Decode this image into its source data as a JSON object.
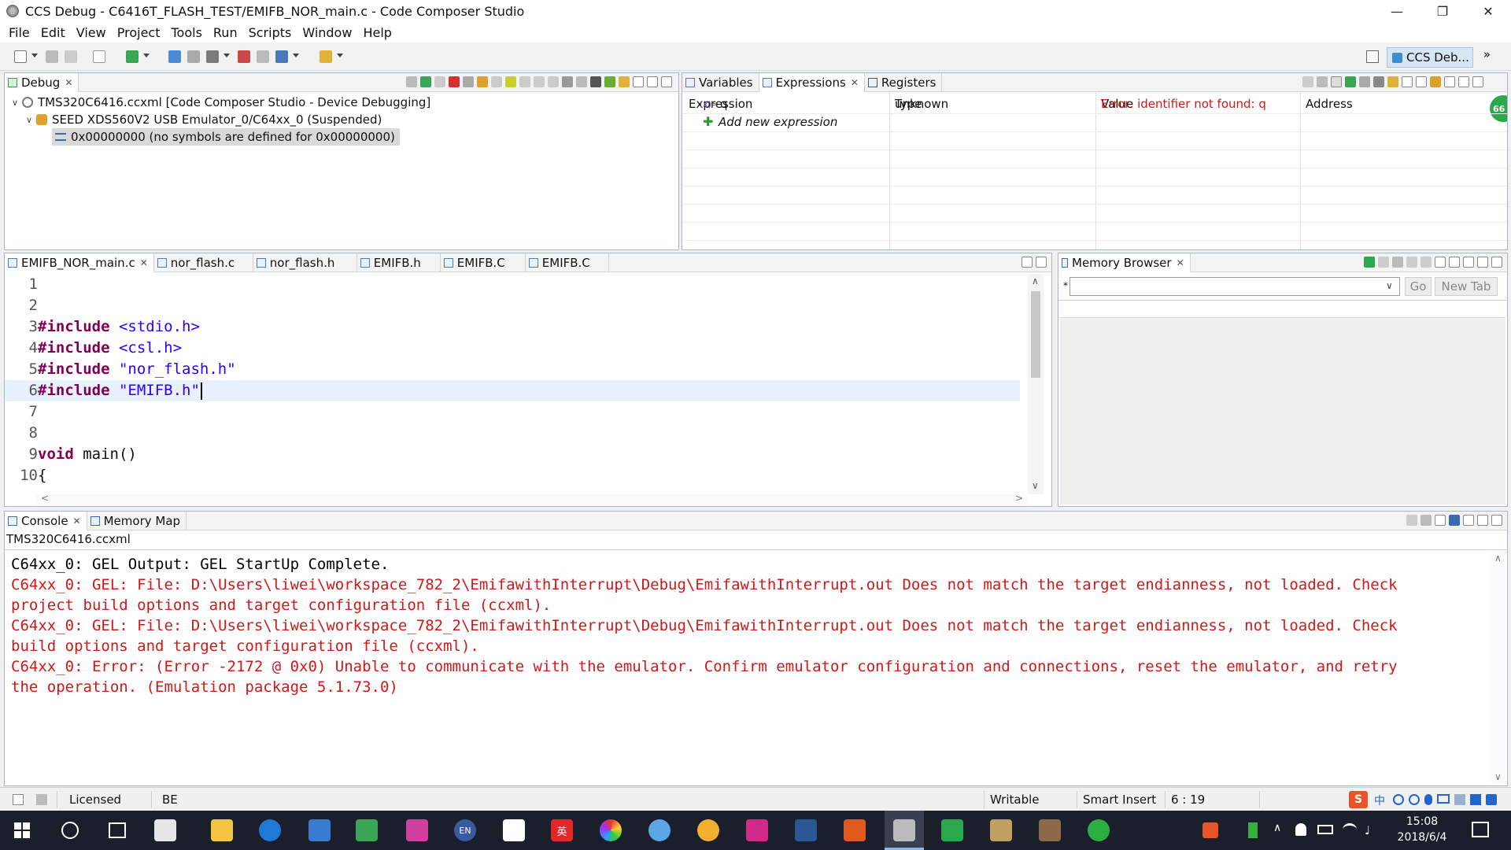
{
  "window": {
    "title": "CCS Debug - C6416T_FLASH_TEST/EMIFB_NOR_main.c - Code Composer Studio",
    "controls": {
      "minimize": "—",
      "restore": "❐",
      "close": "✕"
    }
  },
  "menu": [
    "File",
    "Edit",
    "View",
    "Project",
    "Tools",
    "Run",
    "Scripts",
    "Window",
    "Help"
  ],
  "perspective": {
    "label": "CCS Deb...",
    "more": "»"
  },
  "debug_view": {
    "tab_label": "Debug",
    "tree": [
      {
        "text": "TMS320C6416.ccxml [Code Composer Studio - Device Debugging]",
        "level": 0,
        "expanded": true,
        "icon": "target-config-icon"
      },
      {
        "text": "SEED XDS560V2 USB Emulator_0/C64xx_0 (Suspended)",
        "level": 1,
        "expanded": true,
        "icon": "cpu-core-icon"
      },
      {
        "text": "0x00000000  (no symbols are defined for 0x00000000)",
        "level": 2,
        "selected": true,
        "icon": "stack-frame-icon"
      }
    ]
  },
  "expressions_view": {
    "tabs": [
      {
        "label": "Variables",
        "icon": "variables-icon"
      },
      {
        "label": "Expressions",
        "icon": "expressions-icon",
        "active": true
      },
      {
        "label": "Registers",
        "icon": "registers-icon"
      }
    ],
    "columns": [
      "Expression",
      "Type",
      "Value",
      "Address"
    ],
    "rows": [
      {
        "expression": "q",
        "type": "unknown",
        "value": "Error: identifier not found: q",
        "address": ""
      }
    ],
    "add_new": "Add new expression",
    "badge": "66"
  },
  "editor": {
    "tabs": [
      {
        "label": "EMIFB_NOR_main.c",
        "active": true
      },
      {
        "label": "nor_flash.c"
      },
      {
        "label": "nor_flash.h"
      },
      {
        "label": "EMIFB.h"
      },
      {
        "label": "EMIFB.C"
      },
      {
        "label": "EMIFB.C"
      }
    ],
    "lines": [
      {
        "num": "1",
        "kw": "",
        "text": ""
      },
      {
        "num": "2",
        "kw": "",
        "text": ""
      },
      {
        "num": "3",
        "kw": "#include",
        "text": " <stdio.h>"
      },
      {
        "num": "4",
        "kw": "#include",
        "text": " <csl.h>"
      },
      {
        "num": "5",
        "kw": "#include",
        "text": " \"nor_flash.h\""
      },
      {
        "num": "6",
        "kw": "#include",
        "text": " \"EMIFB.h\""
      },
      {
        "num": "7",
        "kw": "",
        "text": ""
      },
      {
        "num": "8",
        "kw": "",
        "text": ""
      },
      {
        "num": "9",
        "kw": "void",
        "text": " main()"
      },
      {
        "num": "10",
        "kw": "",
        "text": "{"
      }
    ],
    "current_line": 6
  },
  "memory_browser": {
    "tab_label": "Memory Browser",
    "address_placeholder": "",
    "go_label": "Go",
    "new_tab_label": "New Tab"
  },
  "console": {
    "tabs": [
      {
        "label": "Console",
        "active": true
      },
      {
        "label": "Memory Map"
      }
    ],
    "header": "TMS320C6416.ccxml",
    "lines": [
      {
        "text": "C64xx_0: GEL Output: GEL StartUp Complete.",
        "kind": "normal"
      },
      {
        "text": "C64xx_0: GEL: File: D:\\Users\\liwei\\workspace_782_2\\EmifawithInterrupt\\Debug\\EmifawithInterrupt.out Does not match the target endianness, not loaded. Check",
        "kind": "err"
      },
      {
        "text": "project build options and target configuration file (ccxml).",
        "kind": "err"
      },
      {
        "text": "C64xx_0: GEL: File: D:\\Users\\liwei\\workspace_782_2\\EmifawithInterrupt\\Debug\\EmifawithInterrupt.out Does not match the target endianness, not loaded. Check",
        "kind": "err"
      },
      {
        "text": "build options and target configuration file (ccxml).",
        "kind": "err"
      },
      {
        "text": "C64xx_0: Error: (Error -2172 @ 0x0) Unable to communicate with the emulator. Confirm emulator configuration and connections, reset the emulator, and retry",
        "kind": "err"
      },
      {
        "text": "the operation. (Emulation package 5.1.73.0)",
        "kind": "err"
      }
    ]
  },
  "statusbar": {
    "license": "Licensed",
    "endian": "BE",
    "mode": "Writable",
    "insert": "Smart Insert",
    "position": "6 : 19"
  },
  "taskbar": {
    "time": "15:08",
    "date": "2018/6/4",
    "lang": "EN",
    "ime": "英",
    "ime_label": "中"
  },
  "colors": {
    "error": "#d01818",
    "keyword": "#7f0055",
    "string": "#2a00ff",
    "selection": "#cde4f7",
    "panel_border": "#a8b6c8"
  }
}
